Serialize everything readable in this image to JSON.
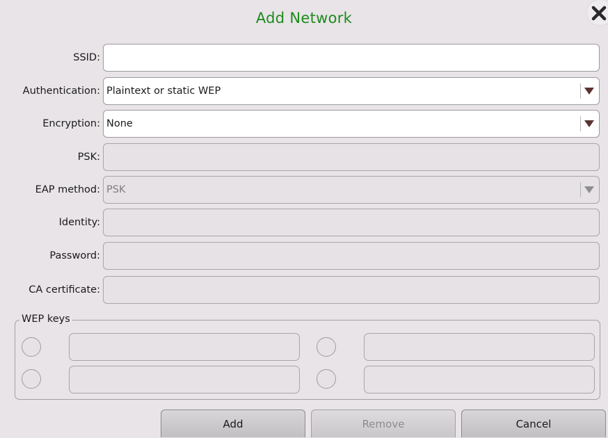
{
  "dialog": {
    "title": "Add Network",
    "close_icon": "close-icon"
  },
  "form": {
    "ssid": {
      "label": "SSID:",
      "value": ""
    },
    "authentication": {
      "label": "Authentication:",
      "value": "Plaintext or static WEP"
    },
    "encryption": {
      "label": "Encryption:",
      "value": "None"
    },
    "psk": {
      "label": "PSK:",
      "value": ""
    },
    "eap_method": {
      "label": "EAP method:",
      "value": "PSK"
    },
    "identity": {
      "label": "Identity:",
      "value": ""
    },
    "password": {
      "label": "Password:",
      "value": ""
    },
    "ca_certificate": {
      "label": "CA certificate:",
      "value": ""
    }
  },
  "wep_keys": {
    "legend": "WEP keys"
  },
  "buttons": {
    "add": "Add",
    "remove": "Remove",
    "cancel": "Cancel"
  },
  "colors": {
    "title": "#1d8a1d",
    "background": "#e8e4e7",
    "arrow": "#5a3232"
  }
}
